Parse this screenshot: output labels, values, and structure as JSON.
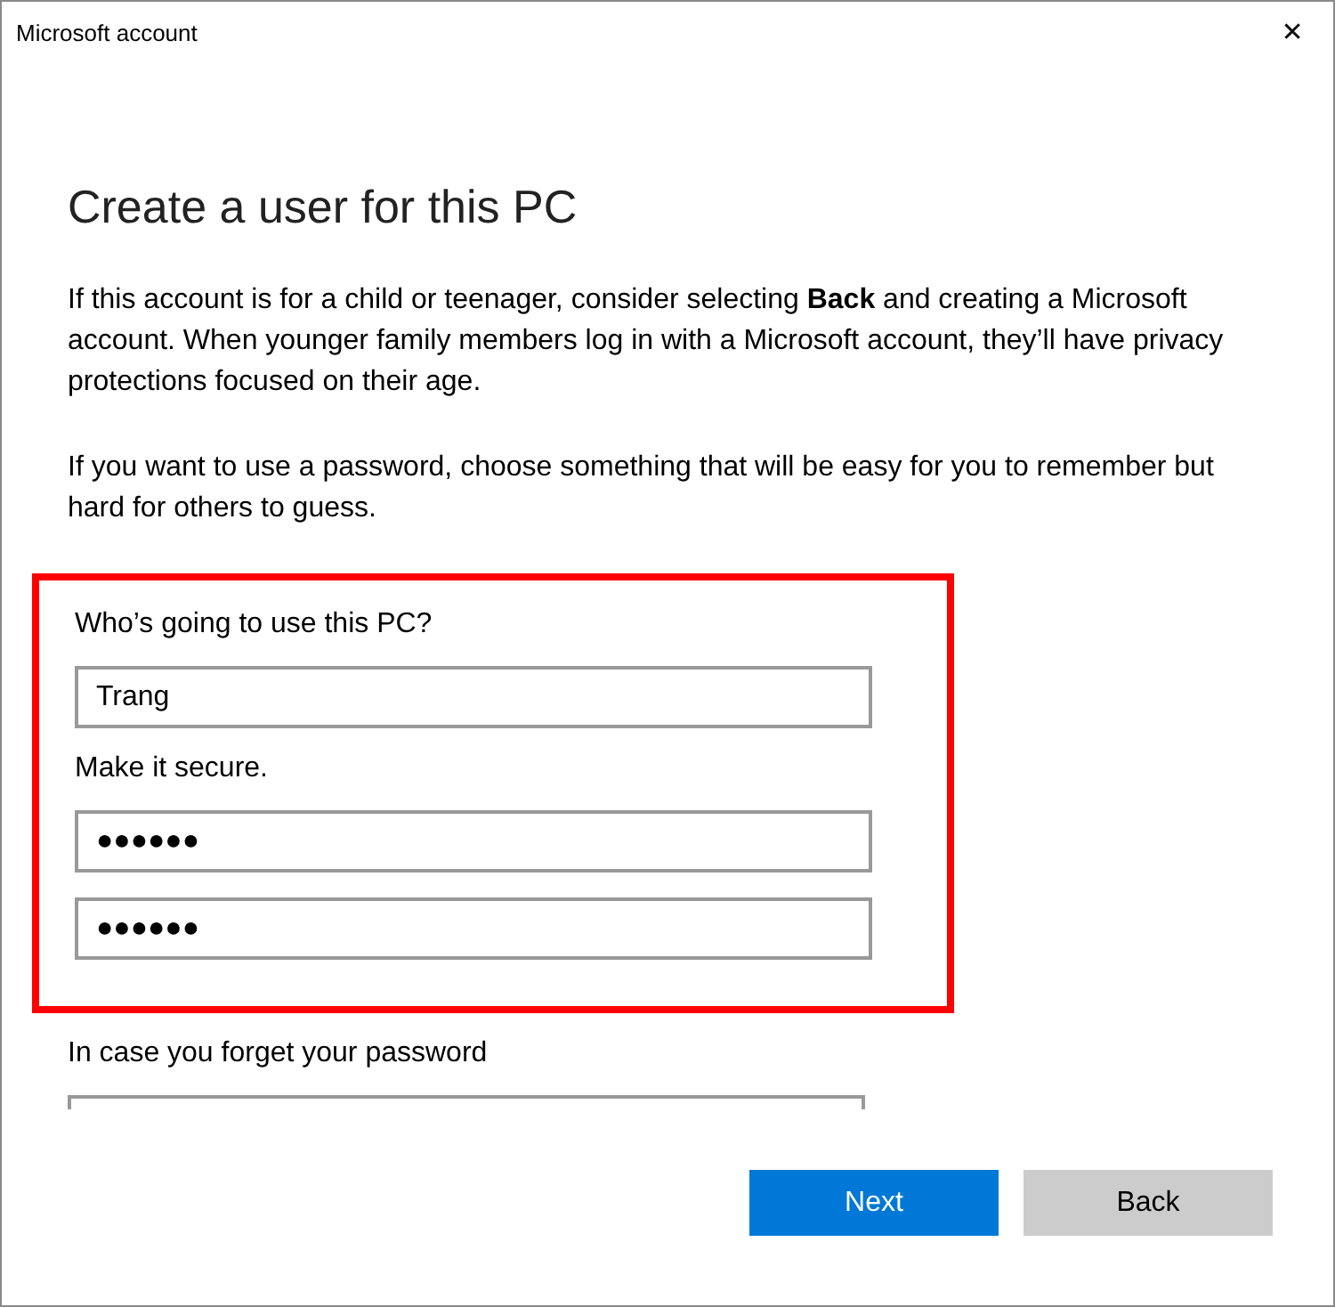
{
  "window": {
    "title": "Microsoft account",
    "close_glyph": "✕"
  },
  "heading": "Create a user for this PC",
  "paragraphs": [
    "If this account is for a child or teenager, consider selecting **Back** and creating a Microsoft account. When younger family members log in with a Microsoft account, they’ll have privacy protections focused on their age.",
    "If you want to use a password, choose something that will be easy for you to remember but hard for others to guess."
  ],
  "form": {
    "highlighted": true,
    "sections": [
      {
        "label": "Who’s going to use this PC?",
        "fields": [
          {
            "value": "Trang"
          }
        ]
      },
      {
        "label": "Make it secure.",
        "fields": [
          {
            "value": "●●●●●●"
          },
          {
            "value": "●●●●●●"
          }
        ]
      }
    ]
  },
  "recovery": {
    "label": "In case you forget your password",
    "field_cut_off": true
  },
  "buttons": [
    {
      "label": "Next",
      "kind": "primary"
    },
    {
      "label": "Back",
      "kind": "secondary"
    }
  ]
}
